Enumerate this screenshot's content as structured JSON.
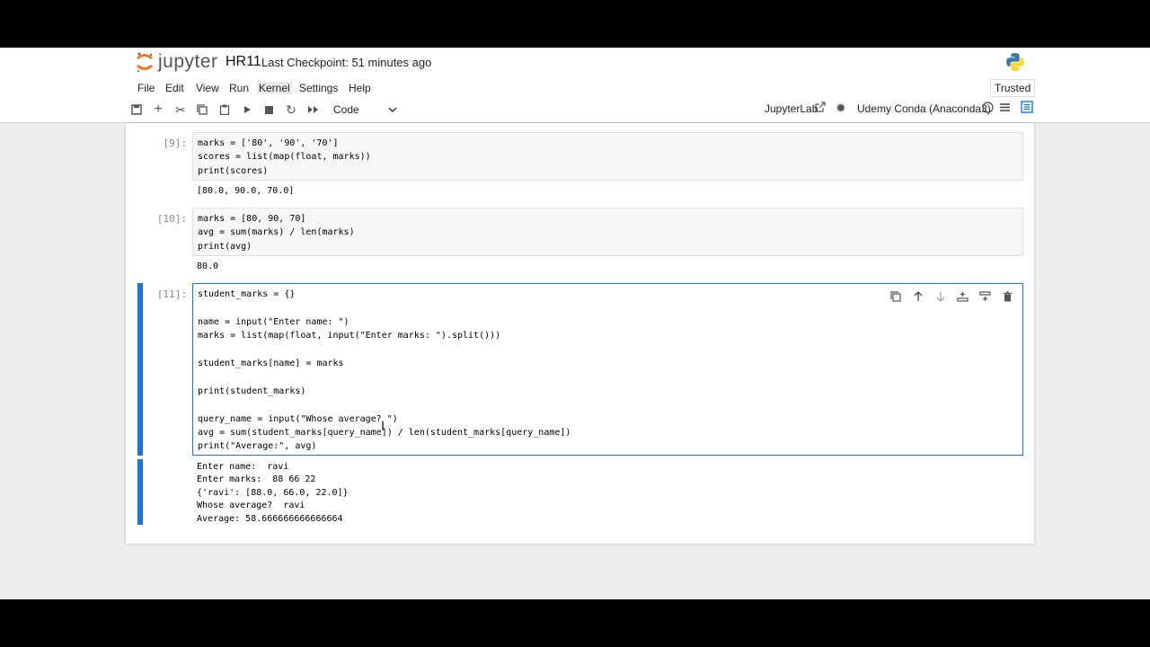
{
  "header": {
    "logo_text": "jupyter",
    "notebook_name": "HR11",
    "checkpoint": "Last Checkpoint: 51 minutes ago"
  },
  "menu": {
    "items": [
      "File",
      "Edit",
      "View",
      "Run",
      "Kernel",
      "Settings",
      "Help"
    ],
    "trusted": "Trusted"
  },
  "toolbar": {
    "cell_type": "Code",
    "jupyterlab_label": "JupyterLab",
    "kernel_name": "Udemy Conda (Anaconda3)"
  },
  "cells": [
    {
      "prompt": "[9]:",
      "code_lines": [
        "marks = ['80', '90', '70']",
        "scores = list(map(float, marks))",
        "print(scores)"
      ],
      "output_lines": [
        "[80.0, 90.0, 70.0]"
      ]
    },
    {
      "prompt": "[10]:",
      "code_lines": [
        "marks = [80, 90, 70]",
        "avg = sum(marks) / len(marks)",
        "print(avg)"
      ],
      "output_lines": [
        "80.0"
      ]
    },
    {
      "prompt": "[11]:",
      "code_lines": [
        "student_marks = {}",
        "",
        "name = input(\"Enter name: \")",
        "marks = list(map(float, input(\"Enter marks: \").split()))",
        "",
        "student_marks[name] = marks",
        "",
        "print(student_marks)",
        "",
        "query_name = input(\"Whose average? \")",
        "avg = sum(student_marks[query_name]) / len(student_marks[query_name])",
        "print(\"Average:\", avg)"
      ],
      "output_lines": [
        "Enter name:  ravi",
        "Enter marks:  88 66 22",
        "{'ravi': [88.0, 66.0, 22.0]}",
        "Whose average?  ravi",
        "Average: 58.666666666666664"
      ]
    }
  ],
  "colors": {
    "accent": "#1976d2",
    "keyword": "#008000",
    "string": "#ba2121"
  }
}
